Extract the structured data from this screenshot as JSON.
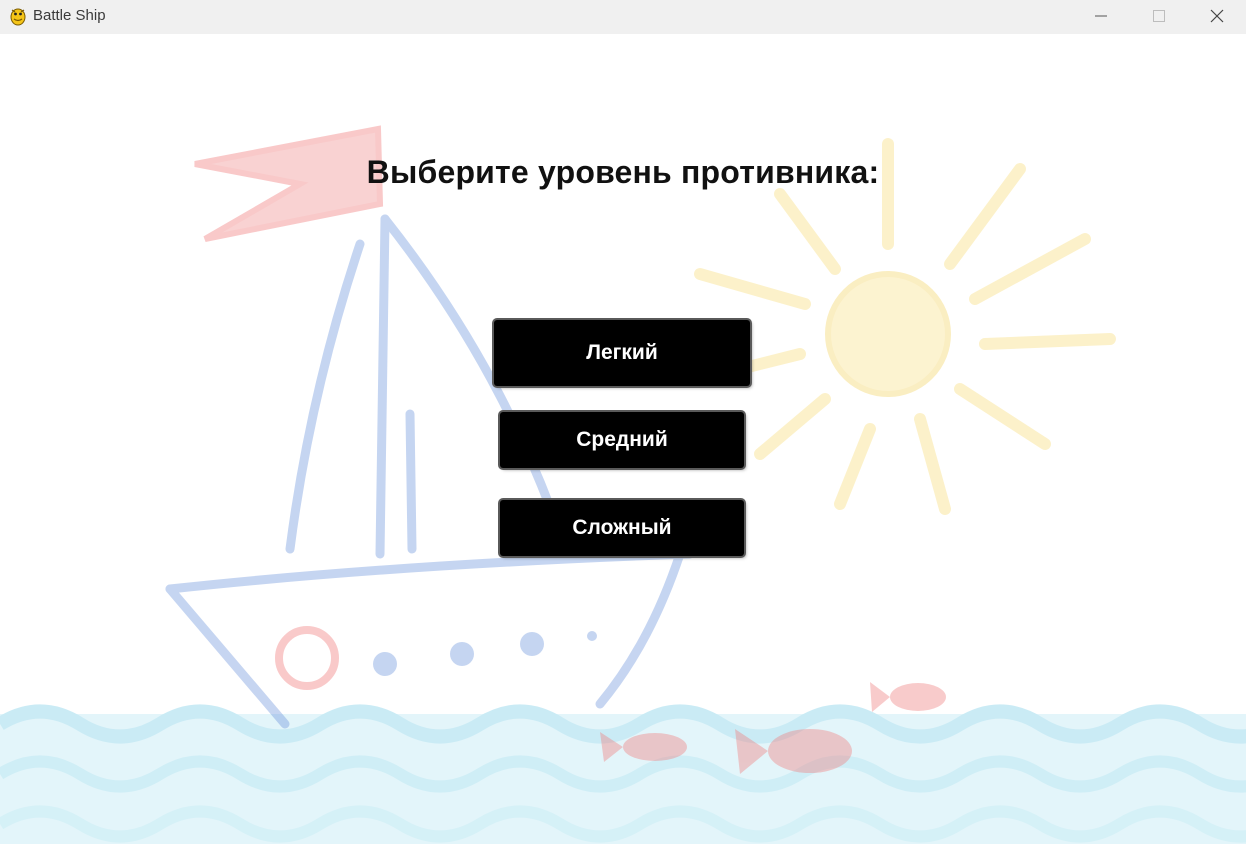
{
  "window": {
    "title": "Battle Ship"
  },
  "screen": {
    "heading": "Выберите уровень противника:"
  },
  "difficulty": {
    "easy_label": "Легкий",
    "medium_label": "Средний",
    "hard_label": "Сложный"
  },
  "colors": {
    "button_bg": "#000000",
    "button_text": "#ffffff",
    "titlebar_bg": "#f0f0f0"
  }
}
